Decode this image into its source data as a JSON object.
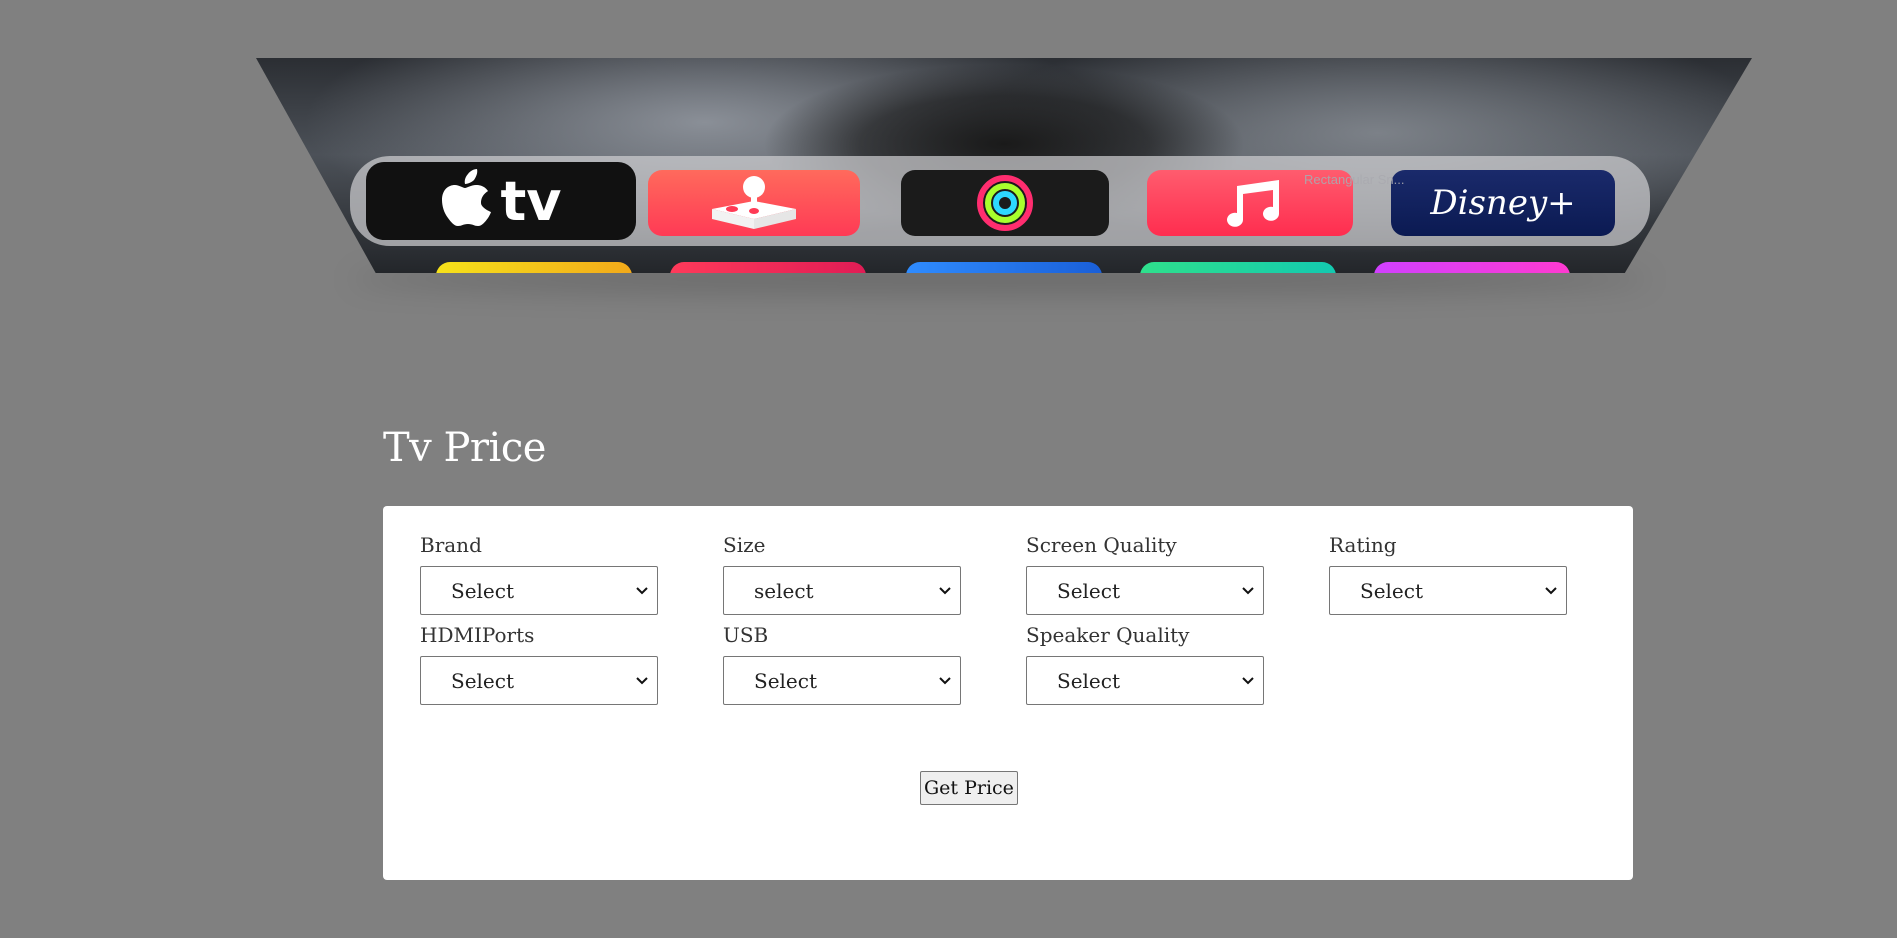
{
  "hero": {
    "apps": [
      {
        "name": "Apple TV",
        "icon": "apple-tv-logo-icon",
        "label": "tv"
      },
      {
        "name": "Arcade",
        "icon": "joystick-icon"
      },
      {
        "name": "Fitness",
        "icon": "activity-rings-icon"
      },
      {
        "name": "Music",
        "icon": "music-note-icon"
      },
      {
        "name": "Disney+",
        "icon": "disney-plus-logo-icon",
        "label": "Disney+"
      }
    ],
    "ghost_text": "Rectangular Sn..."
  },
  "page_title": "Tv Price",
  "form": {
    "fields": [
      {
        "label": "Brand",
        "value": "Select"
      },
      {
        "label": "Size",
        "value": "select"
      },
      {
        "label": "Screen Quality",
        "value": "Select"
      },
      {
        "label": "Rating",
        "value": "Select"
      },
      {
        "label": "HDMIPorts",
        "value": "Select"
      },
      {
        "label": "USB",
        "value": "Select"
      },
      {
        "label": "Speaker Quality",
        "value": "Select"
      }
    ],
    "submit_label": "Get Price"
  },
  "colors": {
    "background": "#808080",
    "card": "#ffffff",
    "title": "#ffffff"
  }
}
